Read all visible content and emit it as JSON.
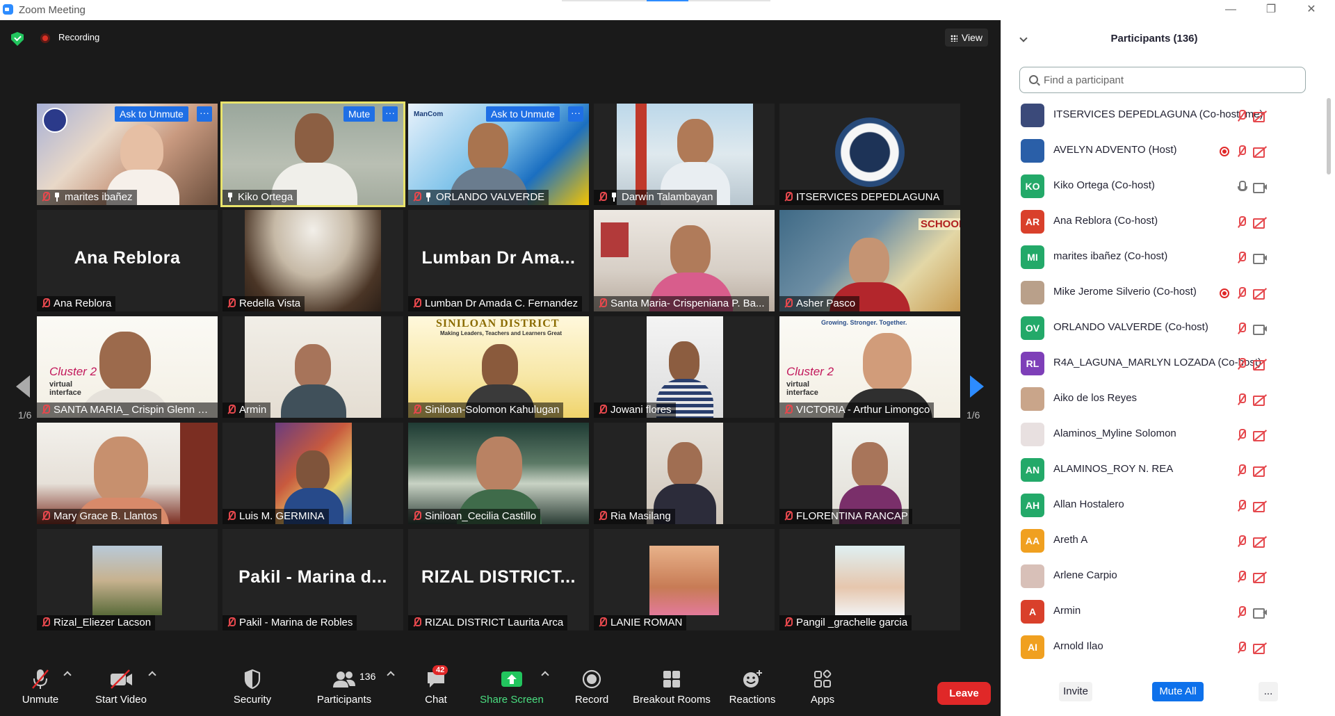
{
  "window": {
    "title": "Zoom Meeting"
  },
  "meeting": {
    "recording_label": "Recording",
    "view_label": "View",
    "page_indicator": "1/6",
    "tile_ask_unmute": "Ask to Unmute",
    "tile_mute": "Mute",
    "tile_more": "···",
    "tiles": [
      {
        "name": "marites ibañez"
      },
      {
        "name": "Kiko Ortega"
      },
      {
        "name": "ORLANDO VALVERDE"
      },
      {
        "name": "Darwin Talambayan"
      },
      {
        "name": "ITSERVICES DEPEDLAGUNA"
      },
      {
        "name": "Ana  Reblora",
        "display": "Ana  Reblora"
      },
      {
        "name": "Redella Vista"
      },
      {
        "name": "Lumban Dr Amada C. Fernandez",
        "display": "Lumban  Dr  Ama..."
      },
      {
        "name": "Santa Maria- Crispeniana P. Ba..."
      },
      {
        "name": "Asher Pasco"
      },
      {
        "name": "SANTA MARIA_ Crispin Glenn C..."
      },
      {
        "name": "Armin"
      },
      {
        "name": "Siniloan-Solomon Kahulugan"
      },
      {
        "name": "Jowani flores"
      },
      {
        "name": "VICTORIA - Arthur Limongco"
      },
      {
        "name": "Mary Grace B. Llantos"
      },
      {
        "name": "Luis M. GERMINA"
      },
      {
        "name": "Siniloan_Cecilia Castillo"
      },
      {
        "name": "Ria Masilang"
      },
      {
        "name": "FLORENTINA RANCAP"
      },
      {
        "name": "Rizal_Eliezer Lacson"
      },
      {
        "name": "Pakil - Marina de Robles",
        "display": "Pakil  -  Marina  d..."
      },
      {
        "name": "RIZAL DISTRICT Laurita Arca",
        "display": "RIZAL  DISTRICT..."
      },
      {
        "name": "LANIE ROMAN"
      },
      {
        "name": "Pangil _grachelle garcia"
      }
    ],
    "tile_texts": {
      "mancom": "ManCom",
      "siniloan_banner": "SINILOAN DISTRICT",
      "siniloan_tagline": "Making Leaders, Teachers and Learners Great",
      "cluster_tagline": "Growing. Stronger. Together.",
      "cluster_title": "Cluster 2",
      "cluster_sub": "virtual interface",
      "school_sign": "SCHOOL"
    }
  },
  "toolbar": {
    "unmute": "Unmute",
    "start_video": "Start Video",
    "security": "Security",
    "participants": "Participants",
    "participants_count": "136",
    "chat": "Chat",
    "chat_badge": "42",
    "share_screen": "Share Screen",
    "record": "Record",
    "breakout_rooms": "Breakout Rooms",
    "reactions": "Reactions",
    "apps": "Apps",
    "leave": "Leave"
  },
  "panel": {
    "title": "Participants (136)",
    "search_placeholder": "Find a participant",
    "participants": [
      {
        "name": "ITSERVICES DEPEDLAGUNA (Co-host, me)",
        "initials": "",
        "color": "#3b4a7a",
        "recording": false,
        "mic": "off",
        "cam": "off"
      },
      {
        "name": "AVELYN ADVENTO (Host)",
        "initials": "",
        "color": "#2a5fa8",
        "recording": true,
        "mic": "off",
        "cam": "off"
      },
      {
        "name": "Kiko Ortega (Co-host)",
        "initials": "KO",
        "color": "#23a969",
        "recording": false,
        "mic": "on",
        "cam": "on"
      },
      {
        "name": "Ana  Reblora (Co-host)",
        "initials": "AR",
        "color": "#d9402b",
        "recording": false,
        "mic": "off",
        "cam": "off"
      },
      {
        "name": "marites ibañez (Co-host)",
        "initials": "MI",
        "color": "#23a969",
        "recording": false,
        "mic": "off",
        "cam": "on"
      },
      {
        "name": "Mike Jerome Silverio (Co-host)",
        "initials": "",
        "color": "#b9a08a",
        "recording": true,
        "mic": "off",
        "cam": "off"
      },
      {
        "name": "ORLANDO VALVERDE (Co-host)",
        "initials": "OV",
        "color": "#23a969",
        "recording": false,
        "mic": "off",
        "cam": "on"
      },
      {
        "name": "R4A_LAGUNA_MARLYN LOZADA (Co-host)",
        "initials": "RL",
        "color": "#7e3fb8",
        "recording": false,
        "mic": "off",
        "cam": "off"
      },
      {
        "name": "Aiko de los Reyes",
        "initials": "",
        "color": "#c9a58a",
        "recording": false,
        "mic": "off",
        "cam": "off"
      },
      {
        "name": "Alaminos_Myline Solomon",
        "initials": "",
        "color": "#e8e0e0",
        "recording": false,
        "mic": "off",
        "cam": "off"
      },
      {
        "name": "ALAMINOS_ROY N. REA",
        "initials": "AN",
        "color": "#23a969",
        "recording": false,
        "mic": "off",
        "cam": "off"
      },
      {
        "name": "Allan Hostalero",
        "initials": "AH",
        "color": "#23a969",
        "recording": false,
        "mic": "off",
        "cam": "off"
      },
      {
        "name": "Areth A",
        "initials": "AA",
        "color": "#f0a020",
        "recording": false,
        "mic": "off",
        "cam": "off"
      },
      {
        "name": "Arlene Carpio",
        "initials": "",
        "color": "#d8c0b8",
        "recording": false,
        "mic": "off",
        "cam": "off"
      },
      {
        "name": "Armin",
        "initials": "A",
        "color": "#d9402b",
        "recording": false,
        "mic": "off",
        "cam": "on"
      },
      {
        "name": "Arnold Ilao",
        "initials": "AI",
        "color": "#f0a020",
        "recording": false,
        "mic": "off",
        "cam": "off"
      }
    ],
    "invite": "Invite",
    "mute_all": "Mute All",
    "more": "..."
  }
}
